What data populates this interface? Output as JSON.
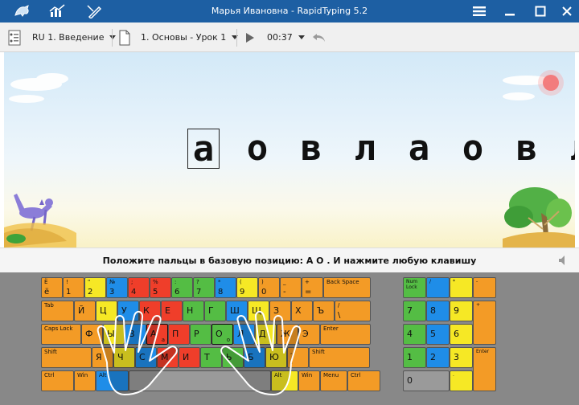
{
  "window": {
    "title": "Марья Ивановна - RapidTyping 5.2",
    "icons": [
      "app-logo-icon",
      "statistics-icon",
      "lessons-editor-icon",
      "menu-icon",
      "minimize-icon",
      "maximize-icon",
      "close-icon"
    ]
  },
  "toolbar": {
    "layout_label": "RU 1. Введение",
    "lesson_label": "1. Основы - Урок 1",
    "timer": "00:37",
    "play_icon": "play-icon",
    "undo_icon": "undo-icon",
    "lesson_icon": "lesson-file-icon",
    "keyboard_icon": "keyboard-layout-icon"
  },
  "text": {
    "letters": [
      "а",
      "о",
      "в",
      "л",
      "а",
      "о",
      "в",
      "л"
    ],
    "current_index": 0
  },
  "instruction": "Положите пальцы в базовую позицию:  А  О .  И нажмите любую клавишу",
  "colors": {
    "orange": "#f39b26",
    "yellow": "#f6e825",
    "green": "#54bd44",
    "blue": "#1f8de8",
    "red": "#ef3e2a",
    "gray": "#9a9a9a",
    "titlebar": "#1d5fa3"
  },
  "keyboard": {
    "row1": [
      {
        "t": "Ё",
        "b": "ё",
        "c": "orange"
      },
      {
        "t": "!",
        "b": "1",
        "c": "orange"
      },
      {
        "t": "\"",
        "b": "2",
        "c": "yellow"
      },
      {
        "t": "№",
        "b": "3",
        "c": "blue"
      },
      {
        "t": ";",
        "b": "4",
        "c": "red"
      },
      {
        "t": "%",
        "b": "5",
        "c": "red"
      },
      {
        "t": ":",
        "b": "6",
        "c": "green"
      },
      {
        "t": "?",
        "b": "7",
        "c": "green"
      },
      {
        "t": "*",
        "b": "8",
        "c": "blue"
      },
      {
        "t": "(",
        "b": "9",
        "c": "yellow"
      },
      {
        "t": ")",
        "b": "0",
        "c": "orange"
      },
      {
        "t": "_",
        "b": "-",
        "c": "orange"
      },
      {
        "t": "+",
        "b": "=",
        "c": "orange"
      },
      {
        "t": "Back Space",
        "b": "",
        "c": "orange"
      }
    ],
    "row2": [
      {
        "t": "Tab",
        "m": "",
        "c": "orange"
      },
      {
        "m": "Й",
        "c": "orange"
      },
      {
        "m": "Ц",
        "c": "yellow"
      },
      {
        "m": "У",
        "c": "blue"
      },
      {
        "m": "К",
        "c": "red"
      },
      {
        "m": "Е",
        "c": "red"
      },
      {
        "m": "Н",
        "c": "green"
      },
      {
        "m": "Г",
        "c": "green"
      },
      {
        "m": "Ш",
        "c": "blue"
      },
      {
        "m": "Щ",
        "c": "yellow"
      },
      {
        "m": "З",
        "c": "orange"
      },
      {
        "m": "Х",
        "c": "orange"
      },
      {
        "m": "Ъ",
        "c": "orange"
      },
      {
        "t": "/",
        "b": "\\",
        "c": "orange"
      }
    ],
    "row3": [
      {
        "t": "Caps Lock",
        "m": "",
        "c": "orange"
      },
      {
        "m": "Ф",
        "c": "orange"
      },
      {
        "m": "Ы",
        "c": "yellow"
      },
      {
        "m": "В",
        "c": "blue"
      },
      {
        "m": "А",
        "c": "red",
        "lr": "а"
      },
      {
        "m": "П",
        "c": "red"
      },
      {
        "m": "Р",
        "c": "green"
      },
      {
        "m": "О",
        "c": "green",
        "lr": "о"
      },
      {
        "m": "Л",
        "c": "blue"
      },
      {
        "m": "Д",
        "c": "yellow"
      },
      {
        "m": "Ж",
        "c": "orange"
      },
      {
        "m": "Э",
        "c": "orange"
      },
      {
        "t": "Enter",
        "m": "",
        "c": "orange"
      }
    ],
    "row4": [
      {
        "t": "Shift",
        "m": "",
        "c": "orange"
      },
      {
        "m": "Я",
        "c": "orange"
      },
      {
        "m": "Ч",
        "c": "yellow"
      },
      {
        "m": "С",
        "c": "blue"
      },
      {
        "m": "М",
        "c": "red"
      },
      {
        "m": "И",
        "c": "red"
      },
      {
        "m": "Т",
        "c": "green"
      },
      {
        "m": "Ь",
        "c": "green"
      },
      {
        "m": "Б",
        "c": "blue"
      },
      {
        "m": "Ю",
        "c": "yellow"
      },
      {
        "t": ",",
        "b": ".",
        "c": "orange"
      },
      {
        "t": "Shift",
        "m": "",
        "c": "orange"
      }
    ],
    "row5": [
      {
        "t": "Ctrl",
        "c": "orange"
      },
      {
        "t": "Win",
        "c": "orange"
      },
      {
        "t": "Alt",
        "c": "blue"
      },
      {
        "t": "",
        "c": "gray"
      },
      {
        "t": "Alt",
        "c": "yellow"
      },
      {
        "t": "Win",
        "c": "orange"
      },
      {
        "t": "Menu",
        "c": "orange"
      },
      {
        "t": "Ctrl",
        "c": "orange"
      }
    ],
    "numpad": [
      {
        "t": "Num Lock",
        "c": "green"
      },
      {
        "t": "/",
        "c": "blue"
      },
      {
        "t": "*",
        "c": "yellow"
      },
      {
        "t": "-",
        "c": "orange"
      },
      {
        "m": "7",
        "c": "green"
      },
      {
        "m": "8",
        "c": "blue"
      },
      {
        "m": "9",
        "c": "yellow"
      },
      {
        "t": "+",
        "c": "orange"
      },
      {
        "m": "4",
        "c": "green"
      },
      {
        "m": "5",
        "c": "blue"
      },
      {
        "m": "6",
        "c": "yellow"
      },
      {
        "m": "1",
        "c": "green"
      },
      {
        "m": "2",
        "c": "blue"
      },
      {
        "m": "3",
        "c": "yellow"
      },
      {
        "t": "Enter",
        "c": "orange"
      },
      {
        "m": "0",
        "c": "gray"
      },
      {
        "t": ".",
        "c": "yellow"
      }
    ]
  }
}
